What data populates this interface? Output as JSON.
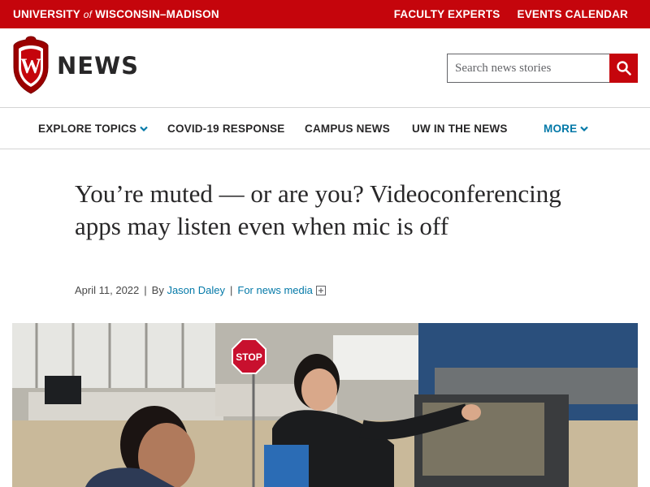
{
  "topbar": {
    "university_prefix": "UNIVERSITY",
    "university_of": "of",
    "university_suffix": "WISCONSIN–MADISON",
    "links": [
      "FACULTY EXPERTS",
      "EVENTS CALENDAR"
    ]
  },
  "header": {
    "crest_letter": "W",
    "site_title": "NEWS",
    "search_placeholder": "Search news stories",
    "search_icon": "magnifier-icon"
  },
  "nav": {
    "items": [
      "EXPLORE TOPICS",
      "COVID-19 RESPONSE",
      "CAMPUS NEWS",
      "UW IN THE NEWS",
      "MORE"
    ]
  },
  "article": {
    "headline": "You’re muted — or are you? Videoconferencing apps may listen even when mic is off",
    "date": "April 11, 2022",
    "by": "By",
    "author": "Jason Daley",
    "media_link": "For news media",
    "photo_sign_text": "STOP"
  },
  "colors": {
    "brand_red": "#c5050c",
    "link_blue": "#0479a8",
    "text": "#282728"
  }
}
